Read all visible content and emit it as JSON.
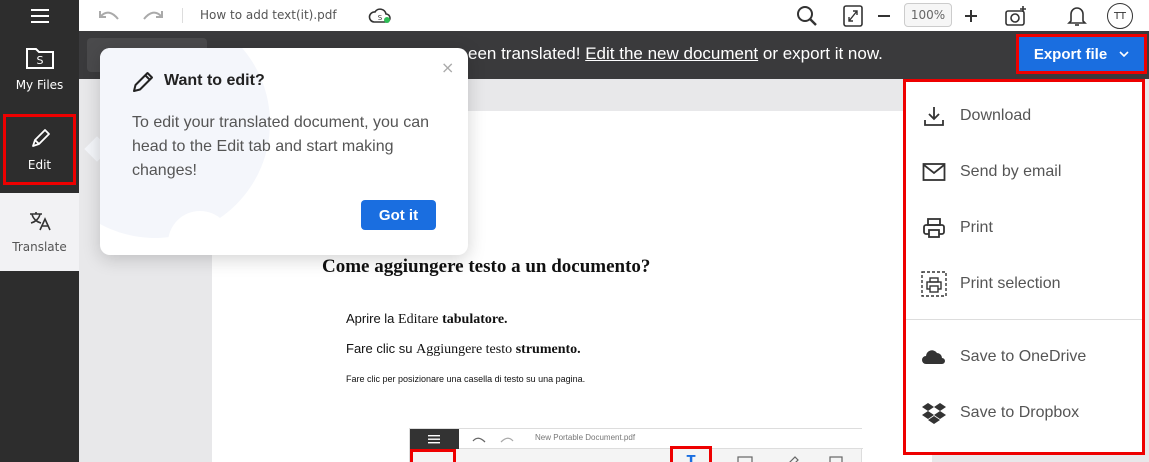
{
  "sidebar": {
    "menu_icon": "hamburger-icon",
    "items": [
      {
        "label": "My Files",
        "icon": "folder-icon"
      },
      {
        "label": "Edit",
        "icon": "pencil-icon"
      },
      {
        "label": "Translate",
        "icon": "translate-icon"
      }
    ]
  },
  "toolbar": {
    "filename": "How to add text(it).pdf",
    "zoom": "100%",
    "avatar_initials": "TT"
  },
  "banner": {
    "text_prefix": "een translated!",
    "link_text": "Edit the new document",
    "text_suffix": " or export it now.",
    "export_label": "Export file"
  },
  "popover": {
    "title": "Want to edit?",
    "body": "To edit your translated document, you can head to the Edit tab and start making changes!",
    "button": "Got it",
    "close": "×"
  },
  "document": {
    "title": "Come aggiungere testo a un documento?",
    "line1_a": "Aprire la ",
    "line1_b": "Editare",
    "line1_c": "tabulatore.",
    "line2_a": "Fare clic su ",
    "line2_b": "Aggiungere testo",
    "line2_c": "strumento.",
    "line3": "Fare clic per posizionare una casella di testo su una pagina.",
    "embedded_filename": "New Portable Document.pdf"
  },
  "export_menu": {
    "items": [
      {
        "label": "Download",
        "icon": "download-icon"
      },
      {
        "label": "Send by email",
        "icon": "mail-icon"
      },
      {
        "label": "Print",
        "icon": "printer-icon"
      },
      {
        "label": "Print selection",
        "icon": "print-selection-icon"
      },
      {
        "label": "Save to OneDrive",
        "icon": "onedrive-icon"
      },
      {
        "label": "Save to Dropbox",
        "icon": "dropbox-icon"
      }
    ]
  },
  "colors": {
    "accent": "#1a6ee0",
    "highlight": "#ee0000",
    "sidebar": "#2d2d2d",
    "banner": "#3a3a3c"
  }
}
